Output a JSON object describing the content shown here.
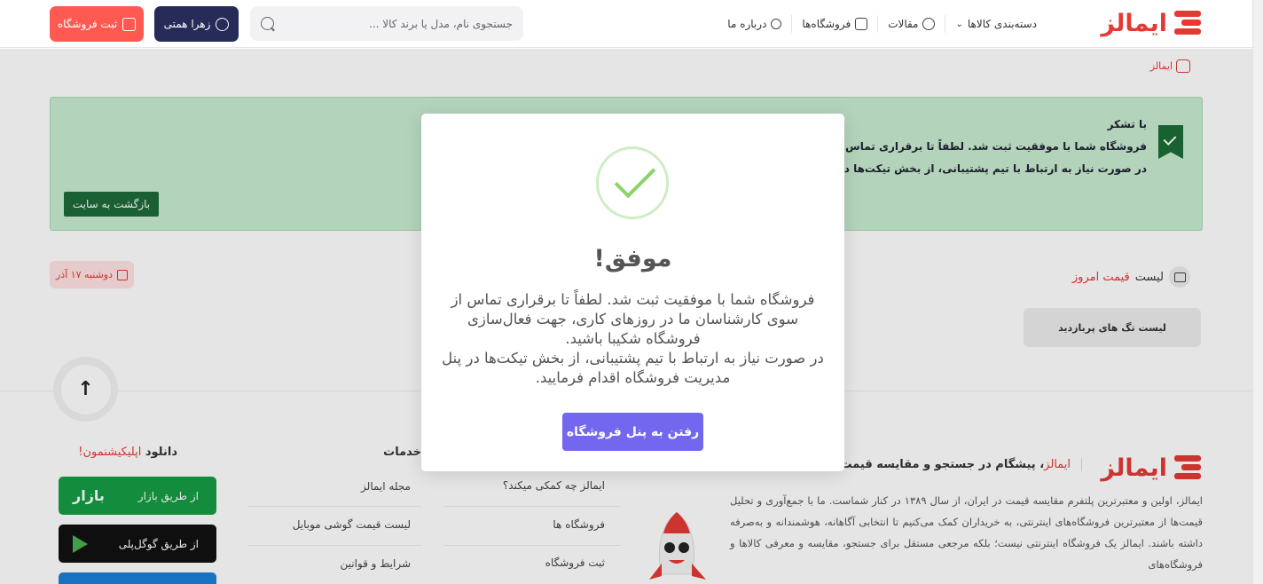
{
  "header": {
    "logo_text": "ایمالز",
    "nav": [
      {
        "label": "دسته‌بندی کالاها",
        "icon": "chevron-down-icon"
      },
      {
        "label": "مقالات",
        "icon": "article-icon"
      },
      {
        "label": "فروشگاه‌ها",
        "icon": "store-icon"
      },
      {
        "label": "درباره ما",
        "icon": "people-icon"
      }
    ],
    "search_placeholder": "جستجوی نام، مدل یا برند کالا ...",
    "user_label": "زهرا همتی",
    "register_label": "ثبت فروشگاه"
  },
  "breadcrumb": {
    "home": "ایمالز"
  },
  "alert": {
    "title": "با تشکر",
    "line1": "فروشگاه شما با موفقیت ثبت شد. لطفاً تا برقراری تماس از سوی کا",
    "line2": "در صورت نیاز به ارتباط با تیم پشتیبانی، از بخش تیکت‌ها در پنل م",
    "back_label": "بازگشت به سایت"
  },
  "price_list": {
    "title_prefix": "لیست",
    "title_highlight": "قیمت امروز",
    "date": "دوشنبه ۱۷ آذر",
    "tags_button": "لیست تگ های پربازدید"
  },
  "footer": {
    "logo_text": "ایمالز",
    "tagline_brand": "ایمالز",
    "tagline_rest": "، پیشگام در جستجو و مقایسه قیمت",
    "about": "ایمالز، اولین و معتبرترین پلتفرم مقایسه قیمت در ایران، از سال ۱۳۸۹ در کنار شماست. ما با جمع‌آوری و تحلیل قیمت‌ها از معتبرترین فروشگاه‌های اینترنتی، به خریداران کمک می‌کنیم تا انتخابی آگاهانه، هوشمندانه و به‌صرفه داشته باشند. ایمالز یک فروشگاه اینترنتی نیست؛ بلکه مرجعی مستقل برای جستجو، مقایسه و معرفی کالاها و فروشگاه‌های",
    "col1_links": [
      "ایمالز چه کمکی میکند؟",
      "فروشگاه ها",
      "ثبت فروشگاه"
    ],
    "services_title": "خدمات",
    "col2_links": [
      "مجله ایمالز",
      "لیست قیمت گوشی موبایل",
      "شرایط و قوانین"
    ],
    "download_title": "دانلود",
    "download_highlight": "اپلیکیشنمون!",
    "stores": [
      {
        "label": "از طریق بازار",
        "brand": "بازار"
      },
      {
        "label": "از طریق گوگل‌پلی",
        "brand": ""
      }
    ]
  },
  "modal": {
    "title": "موفق!",
    "body_line1": "فروشگاه شما با موفقیت ثبت شد. لطفاً تا برقراری تماس از سوی کارشناسان ما در روزهای کاری، جهت فعال‌سازی فروشگاه شکیبا باشید.",
    "body_line2": "در صورت نیاز به ارتباط با تیم پشتیبانی، از بخش تیکت‌ها در پنل مدیریت فروشگاه اقدام فرمایید.",
    "button_label": "رفتن به پنل فروشگاه"
  },
  "colors": {
    "brand_red": "#e53935",
    "navy": "#262b58",
    "success_green": "#8dd36b",
    "modal_button": "#7367f0"
  }
}
